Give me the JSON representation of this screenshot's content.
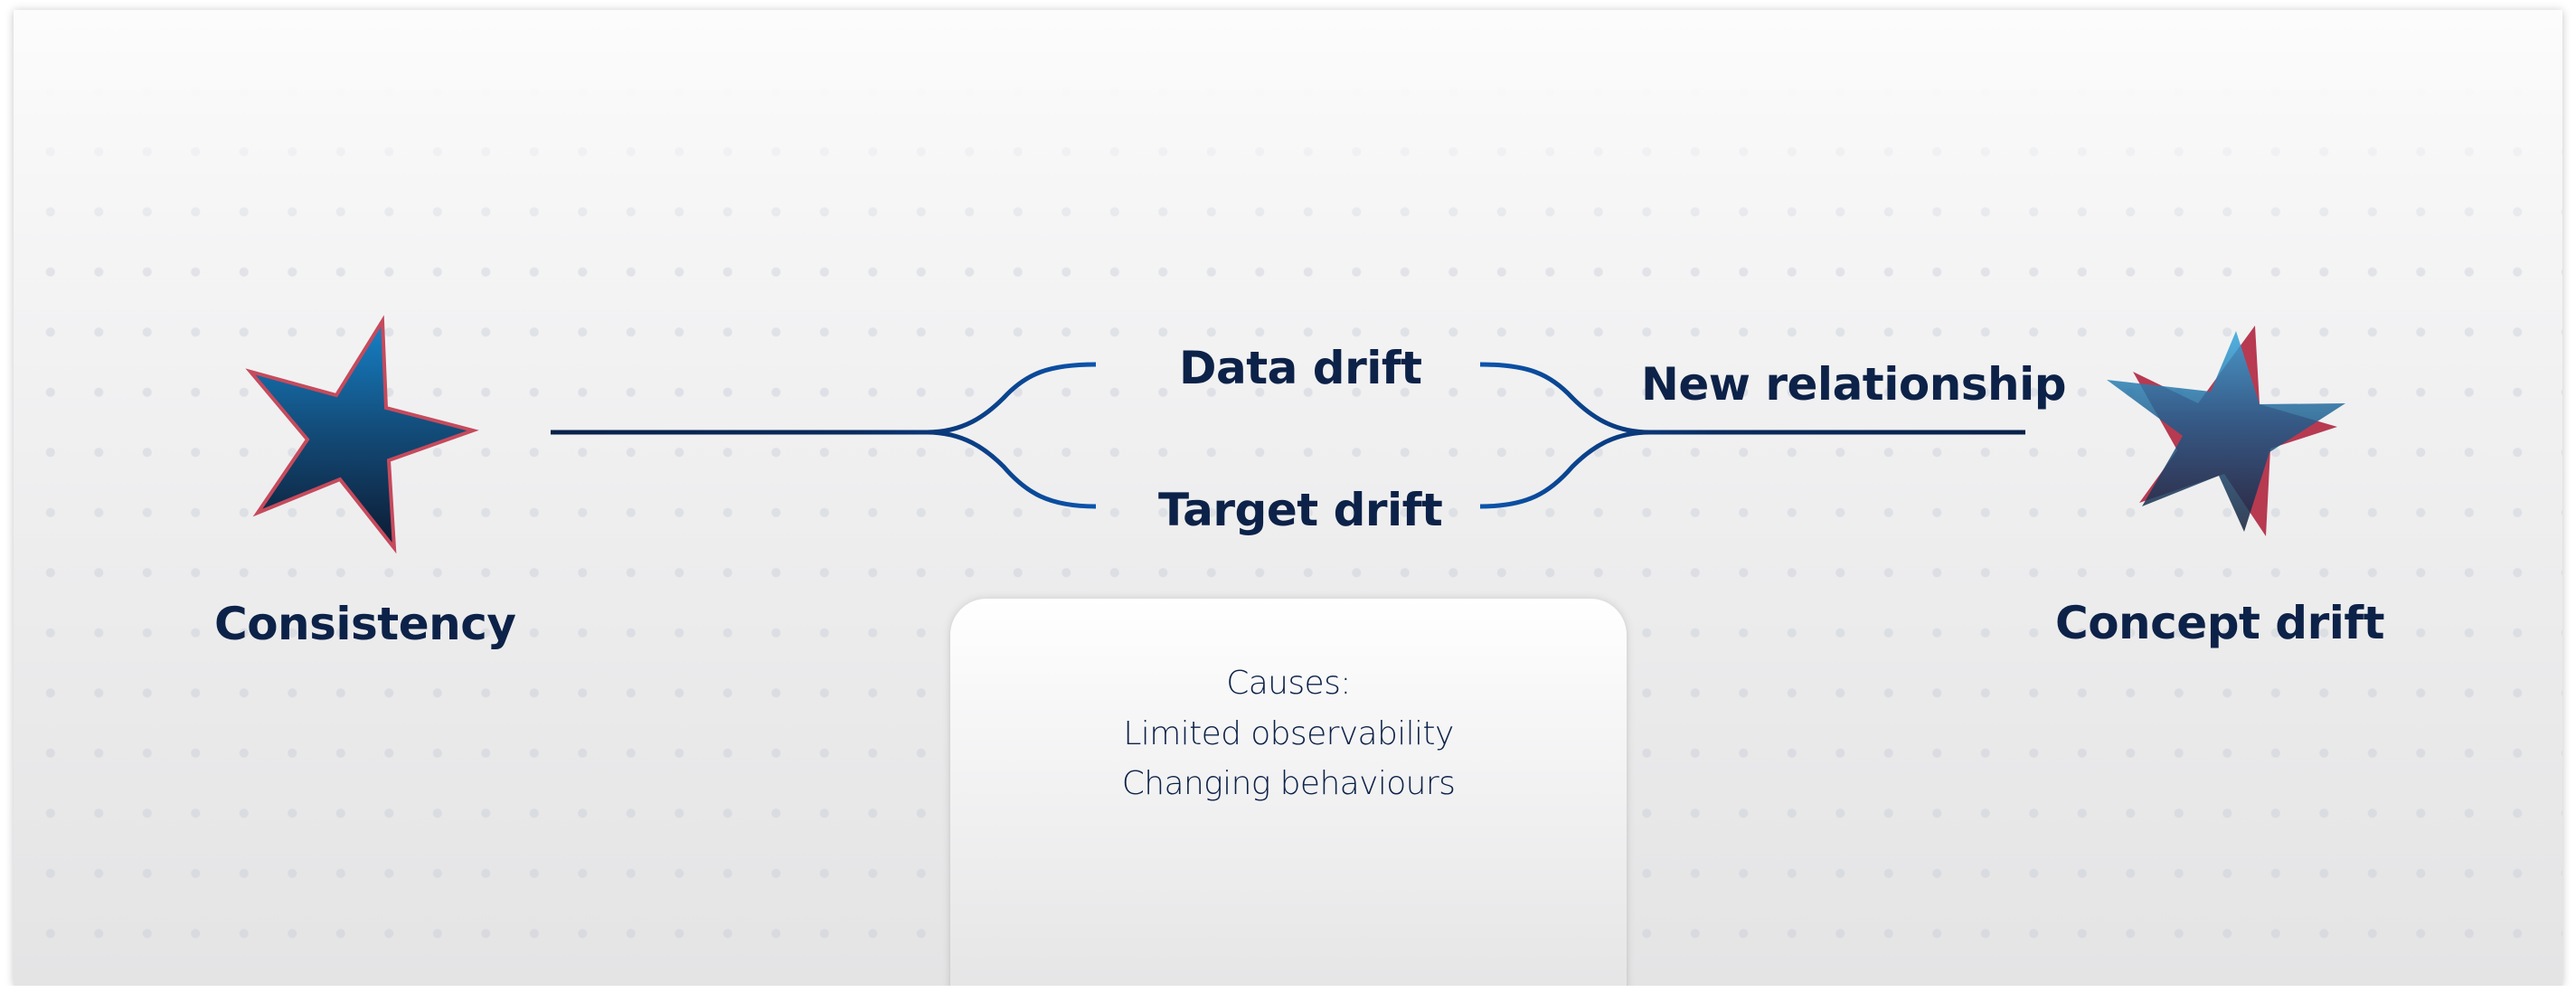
{
  "diagram": {
    "nodes": {
      "start": {
        "label": "Consistency",
        "icon": "star-icon"
      },
      "end": {
        "label": "Concept drift",
        "icon": "double-star-icon"
      }
    },
    "branches": [
      {
        "label": "Data drift"
      },
      {
        "label": "Target drift"
      }
    ],
    "merge_label": "New relationship",
    "causes_card": {
      "title": "Causes:",
      "items": [
        "Limited observability",
        "Changing behaviours"
      ]
    }
  },
  "colors": {
    "text": "#0d2248",
    "line_dark": "#0a2550",
    "line_bright": "#0b55ad",
    "star_top": "#1479bd",
    "star_bottom": "#0e1c35",
    "star_outline": "#c64a5c",
    "red_star": "#b22a43",
    "blue_star": "#2f9fd6"
  }
}
